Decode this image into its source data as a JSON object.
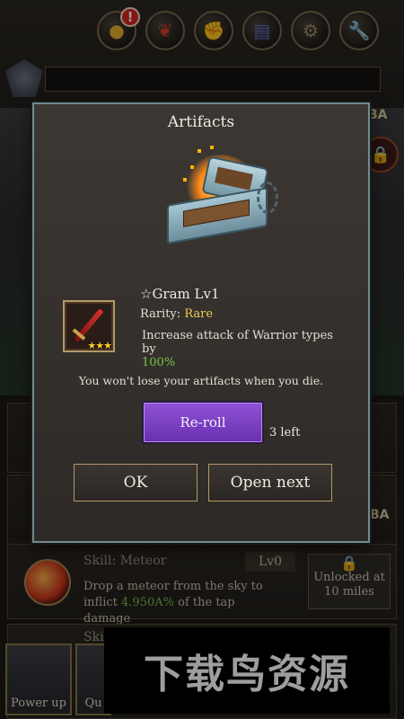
{
  "header": {
    "icons": [
      {
        "name": "gold-coin-icon",
        "glyph": "●",
        "badge": "!"
      },
      {
        "name": "pet-icon",
        "glyph": "❦",
        "badge": ""
      },
      {
        "name": "relic-icon",
        "glyph": "✊",
        "badge": ""
      },
      {
        "name": "book-icon",
        "glyph": "▤",
        "badge": ""
      },
      {
        "name": "gear-icon",
        "glyph": "⚙",
        "badge": ""
      },
      {
        "name": "wrench-icon",
        "glyph": "🔧",
        "badge": ""
      }
    ],
    "right_label": "BA"
  },
  "modal": {
    "title": "Artifacts",
    "item": {
      "name": "☆Gram Lv1",
      "rarity_label": "Rarity:",
      "rarity_value": "Rare",
      "stars": "★★★",
      "desc_text": "Increase attack of Warrior types by",
      "desc_value": "100%"
    },
    "note": "You won't lose your artifacts when you die.",
    "reroll_label": "Re-roll",
    "reroll_left": "3 left",
    "ok_label": "OK",
    "open_next_label": "Open next"
  },
  "skill": {
    "title": "Skill: Meteor",
    "level": "Lv0",
    "desc_pre": "Drop a meteor from the sky to inflict",
    "desc_value": "4.950A%",
    "desc_post": "of the tap damage",
    "unlock_text": "Unlocked at 10 miles",
    "unlock_top": "Unlock"
  },
  "skill2": {
    "title": "Skill"
  },
  "bottom_buttons": {
    "power_up": "Power up",
    "quest": "Qu"
  },
  "watermark": "下载鸟资源",
  "colors": {
    "modal_border": "#6f8b8e",
    "reroll_purple": "#7a3ec4",
    "rarity_rare": "#e8cf52",
    "value_green": "#74c548",
    "button_gold_border": "#b49a62"
  }
}
